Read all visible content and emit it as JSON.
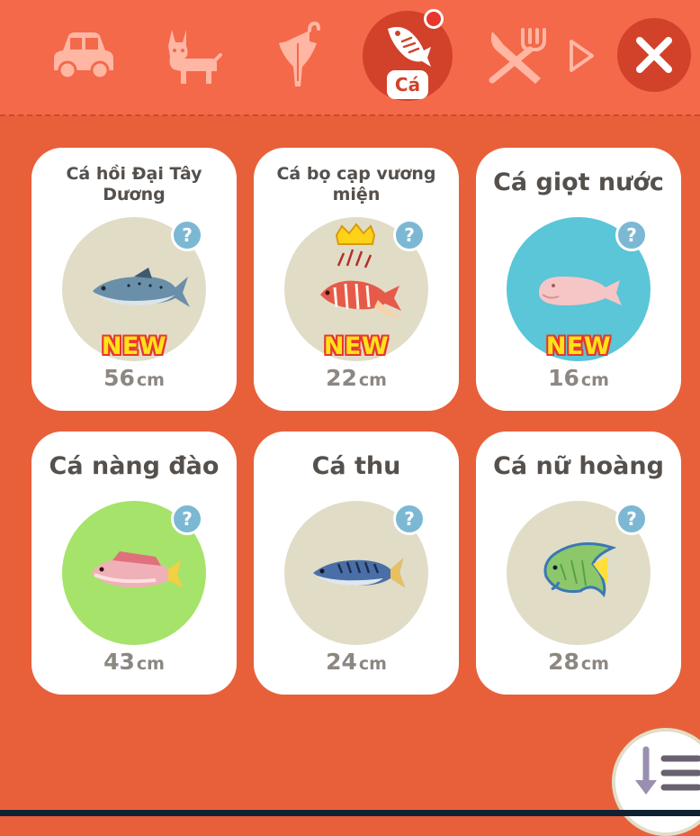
{
  "tabs": [
    {
      "icon": "car-icon",
      "active": false
    },
    {
      "icon": "dog-icon",
      "active": false
    },
    {
      "icon": "umbrella-icon",
      "active": false
    },
    {
      "icon": "fish-icon",
      "active": true,
      "label": "Cá",
      "notification": true
    },
    {
      "icon": "fork-knife-icon",
      "active": false
    }
  ],
  "colors": {
    "topbar": "#f3694a",
    "background": "#e8603a",
    "active_tab": "#d2412a",
    "new_badge": "#ffe21a",
    "question_badge": "#7cb8d4"
  },
  "fish_cards": [
    {
      "name": "Cá hồi Đại Tây Dương",
      "size": "56",
      "unit": "cm",
      "new": "NEW",
      "circle_color": "#e1dcc6",
      "icon": "salmon-icon"
    },
    {
      "name": "Cá bọ cạp vương miện",
      "size": "22",
      "unit": "cm",
      "new": "NEW",
      "circle_color": "#e1dcc6",
      "icon": "lionfish-crown-icon"
    },
    {
      "name": "Cá giọt nước",
      "size": "16",
      "unit": "cm",
      "new": "NEW",
      "circle_color": "#5ac6d8",
      "icon": "blobfish-icon"
    },
    {
      "name": "Cá nàng đào",
      "size": "43",
      "unit": "cm",
      "new": "",
      "circle_color": "#a6e36a",
      "icon": "red-seabream-icon"
    },
    {
      "name": "Cá thu",
      "size": "24",
      "unit": "cm",
      "new": "",
      "circle_color": "#e1dcc6",
      "icon": "mackerel-icon"
    },
    {
      "name": "Cá nữ hoàng",
      "size": "28",
      "unit": "cm",
      "new": "",
      "circle_color": "#e1dcc6",
      "icon": "angelfish-icon"
    }
  ],
  "question_mark": "?"
}
